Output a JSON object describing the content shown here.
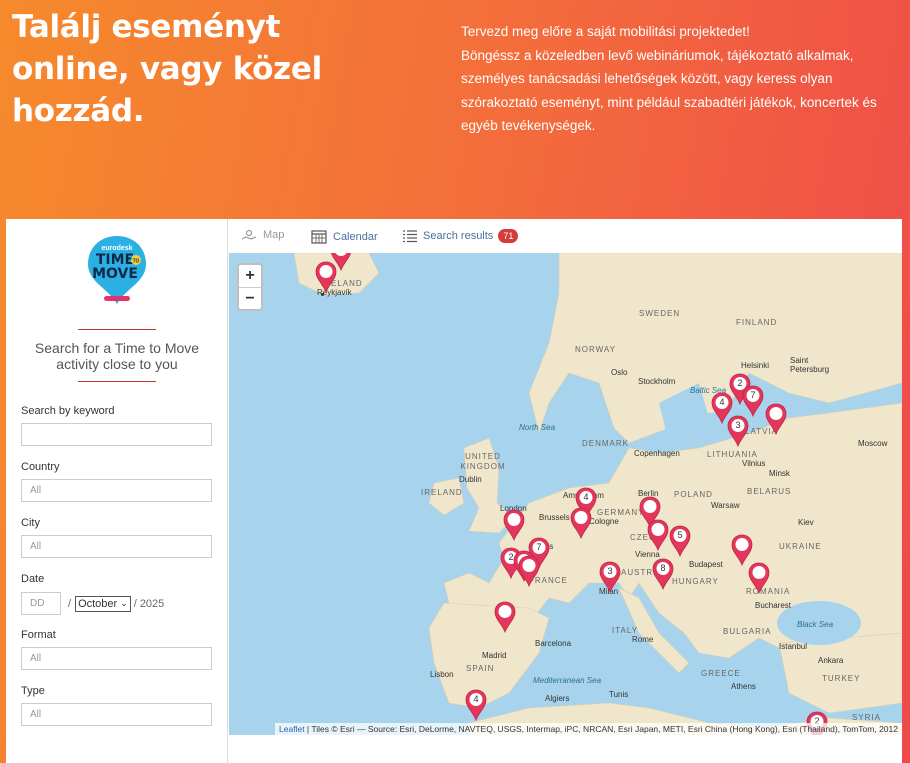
{
  "hero": {
    "title": "Találj eseményt online, vagy közel hozzád.",
    "line1": "Tervezd meg előre a saját mobilitási projektedet!",
    "line2": "Böngéssz a közeledben levő webináriumok, tájékoztató alkalmak, személyes tanácsadási lehetőségek között, vagy keress olyan szórakoztató eseményt, mint például szabadtéri játékok, koncertek és egyéb tevékenységek."
  },
  "logo": {
    "top": "eurodesk",
    "main1": "TIME",
    "main2": "MOVE",
    "badge": "TO"
  },
  "sidebar": {
    "heading": "Search for a Time to Move activity close to you",
    "keyword_label": "Search by keyword",
    "keyword_value": "",
    "country_label": "Country",
    "country_value": "All",
    "city_label": "City",
    "city_value": "All",
    "date_label": "Date",
    "date_day_placeholder": "DD",
    "date_month": "October",
    "date_year": "2025",
    "format_label": "Format",
    "format_value": "All",
    "type_label": "Type",
    "type_value": "All"
  },
  "tabs": {
    "map": "Map",
    "calendar": "Calendar",
    "results": "Search results",
    "results_count": "71"
  },
  "map": {
    "zoom_in": "+",
    "zoom_out": "−",
    "attribution_link": "Leaflet",
    "attribution_text": " | Tiles © Esri — Source: Esri, DeLorme, NAVTEQ, USGS, Intermap, iPC, NRCAN, Esri Japan, METI, Esri China (Hong Kong), Esri (Thailand), TomTom, 2012",
    "labels": {
      "iceland": "ICELAND",
      "reykjavik": "Reykjavík",
      "sweden": "SWEDEN",
      "finland": "FINLAND",
      "norway": "NORWAY",
      "helsinki": "Helsinki",
      "saint_petersburg": "Saint Petersburg",
      "oslo": "Oslo",
      "stockholm": "Stockholm",
      "baltic_sea": "Baltic Sea",
      "north_sea": "North Sea",
      "denmark": "DENMARK",
      "copenhagen": "Copenhagen",
      "latvia": "LATVIA",
      "lithuania": "LITHUANIA",
      "vilnius": "Vilnius",
      "moscow": "Moscow",
      "minsk": "Minsk",
      "belarus": "BELARUS",
      "united_kingdom": "UNITED KINGDOM",
      "dublin": "Dublin",
      "ireland": "IRELAND",
      "london": "London",
      "amsterdam": "Amsterdam",
      "berlin": "Berlin",
      "poland": "POLAND",
      "warsaw": "Warsaw",
      "kiev": "Kiev",
      "ukraine": "UKRAINE",
      "brussels": "Brussels",
      "cologne": "Cologne",
      "germany": "GERMANY",
      "czech": "CZECH",
      "vienna": "Vienna",
      "paris": "Paris",
      "france": "FRANCE",
      "austria": "AUSTRIA",
      "hungary": "HUNGARY",
      "budapest": "Budapest",
      "romania": "ROMANIA",
      "bucharest": "Bucharest",
      "milan": "Milan",
      "italy": "ITALY",
      "rome": "Rome",
      "bulgaria": "BULGARIA",
      "black_sea": "Black Sea",
      "barcelona": "Barcelona",
      "madrid": "Madrid",
      "spain": "SPAIN",
      "lisbon": "Lisbon",
      "istanbul": "Istanbul",
      "ankara": "Ankara",
      "turkey": "TURKEY",
      "greece": "GREECE",
      "athens": "Athens",
      "mediterranean_sea": "Mediterranean Sea",
      "tunis": "Tunis",
      "algiers": "Algiers",
      "syria": "SYRIA"
    },
    "markers": [
      {
        "name": "marker-iceland-top",
        "num": ""
      },
      {
        "name": "marker-reykjavik",
        "num": ""
      },
      {
        "name": "marker-helsinki",
        "num": "2"
      },
      {
        "name": "marker-tallinn",
        "num": "7"
      },
      {
        "name": "marker-riga-west",
        "num": "4"
      },
      {
        "name": "marker-riga-east",
        "num": ""
      },
      {
        "name": "marker-riga",
        "num": "3"
      },
      {
        "name": "marker-amsterdam",
        "num": "4"
      },
      {
        "name": "marker-cologne",
        "num": ""
      },
      {
        "name": "marker-berlin",
        "num": ""
      },
      {
        "name": "marker-prague",
        "num": ""
      },
      {
        "name": "marker-vienna-north",
        "num": "5"
      },
      {
        "name": "marker-london",
        "num": ""
      },
      {
        "name": "marker-paris-west",
        "num": "2"
      },
      {
        "name": "marker-paris",
        "num": "7"
      },
      {
        "name": "marker-paris-south",
        "num": ""
      },
      {
        "name": "marker-paris-south2",
        "num": ""
      },
      {
        "name": "marker-milan",
        "num": "3"
      },
      {
        "name": "marker-graz",
        "num": "8"
      },
      {
        "name": "marker-ukraine",
        "num": ""
      },
      {
        "name": "marker-romania",
        "num": ""
      },
      {
        "name": "marker-bordeaux",
        "num": ""
      },
      {
        "name": "marker-spain-south",
        "num": "4"
      },
      {
        "name": "marker-cyprus",
        "num": "2"
      }
    ]
  }
}
